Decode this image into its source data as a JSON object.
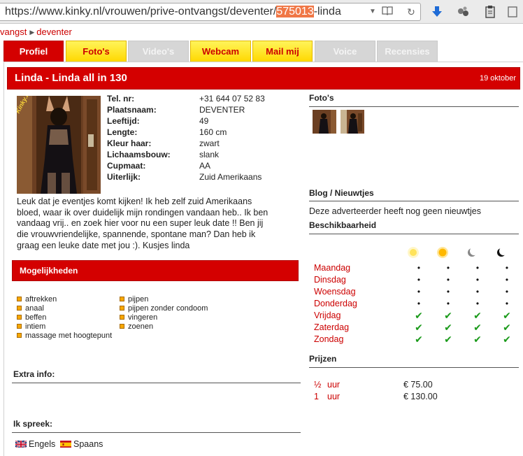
{
  "browser": {
    "url_prefix": "https://www.kinky.nl/vrouwen/prive-ontvangst/deventer/",
    "url_selected": "575013",
    "url_suffix": "-linda"
  },
  "breadcrumb": {
    "item1": "vangst",
    "item2": "deventer"
  },
  "tabs": [
    {
      "label": "Profiel",
      "state": "active"
    },
    {
      "label": "Foto's",
      "state": "yellow"
    },
    {
      "label": "Video's",
      "state": "disabled"
    },
    {
      "label": "Webcam",
      "state": "yellow"
    },
    {
      "label": "Mail mij",
      "state": "yellow"
    },
    {
      "label": "Voice",
      "state": "disabled"
    },
    {
      "label": "Recensies",
      "state": "disabled"
    }
  ],
  "profile": {
    "title": "Linda - Linda all in 130",
    "date": "19 oktober",
    "photo_watermark": "Kinky.nl",
    "details": [
      {
        "label": "Tel. nr:",
        "value": "+31 644 07 52 83"
      },
      {
        "label": "Plaatsnaam:",
        "value": "DEVENTER"
      },
      {
        "label": "Leeftijd:",
        "value": "49"
      },
      {
        "label": "Lengte:",
        "value": "160 cm"
      },
      {
        "label": "Kleur haar:",
        "value": "zwart"
      },
      {
        "label": "Lichaamsbouw:",
        "value": "slank"
      },
      {
        "label": "Cupmaat:",
        "value": "AA"
      },
      {
        "label": "Uiterlijk:",
        "value": "Zuid Amerikaans"
      }
    ],
    "description": "Leuk dat je eventjes komt kijken! Ik heb zelf zuid Amerikaans bloed, waar ik over duidelijk mijn rondingen vandaan heb.. Ik ben vandaag vrij.. en zoek hier voor nu een super leuk date !! Ben jij die vrouwvriendelijke, spannende, spontane man? Dan heb ik graag een leuke date met jou :). Kusjes linda"
  },
  "mogelijkheden": {
    "title": "Mogelijkheden",
    "col1": [
      "aftrekken",
      "anaal",
      "beffen",
      "intiem",
      "massage met hoogtepunt"
    ],
    "col2": [
      "pijpen",
      "pijpen zonder condoom",
      "vingeren",
      "zoenen"
    ]
  },
  "extra": {
    "title": "Extra info:"
  },
  "talen": {
    "title": "Ik spreek:",
    "items": [
      {
        "name": "Engels",
        "flag": "uk-flag"
      },
      {
        "name": "Spaans",
        "flag": "spain-flag"
      }
    ]
  },
  "fotos": {
    "title": "Foto's",
    "count": 2
  },
  "blog": {
    "title": "Blog / Nieuwtjes",
    "text": "Deze adverteerder heeft nog geen nieuwtjes"
  },
  "beschikbaarheid": {
    "title": "Beschikbaarheid",
    "dayparts": [
      "morning-sun-icon",
      "afternoon-sun-icon",
      "evening-moon-icon",
      "night-moon-icon"
    ],
    "days": [
      {
        "day": "Maandag",
        "slots": [
          false,
          false,
          false,
          false
        ]
      },
      {
        "day": "Dinsdag",
        "slots": [
          false,
          false,
          false,
          false
        ]
      },
      {
        "day": "Woensdag",
        "slots": [
          false,
          false,
          false,
          false
        ]
      },
      {
        "day": "Donderdag",
        "slots": [
          false,
          false,
          false,
          false
        ]
      },
      {
        "day": "Vrijdag",
        "slots": [
          true,
          true,
          true,
          true
        ]
      },
      {
        "day": "Zaterdag",
        "slots": [
          true,
          true,
          true,
          true
        ]
      },
      {
        "day": "Zondag",
        "slots": [
          true,
          true,
          true,
          true
        ]
      }
    ]
  },
  "prijzen": {
    "title": "Prijzen",
    "items": [
      {
        "qty": "½",
        "unit": "uur",
        "price": "€ 75.00"
      },
      {
        "qty": "1",
        "unit": "uur",
        "price": "€ 130.00"
      }
    ]
  },
  "colors": {
    "brand_red": "#d40000",
    "tab_yellow": "#ffd800",
    "check_green": "#1a9a1a"
  }
}
